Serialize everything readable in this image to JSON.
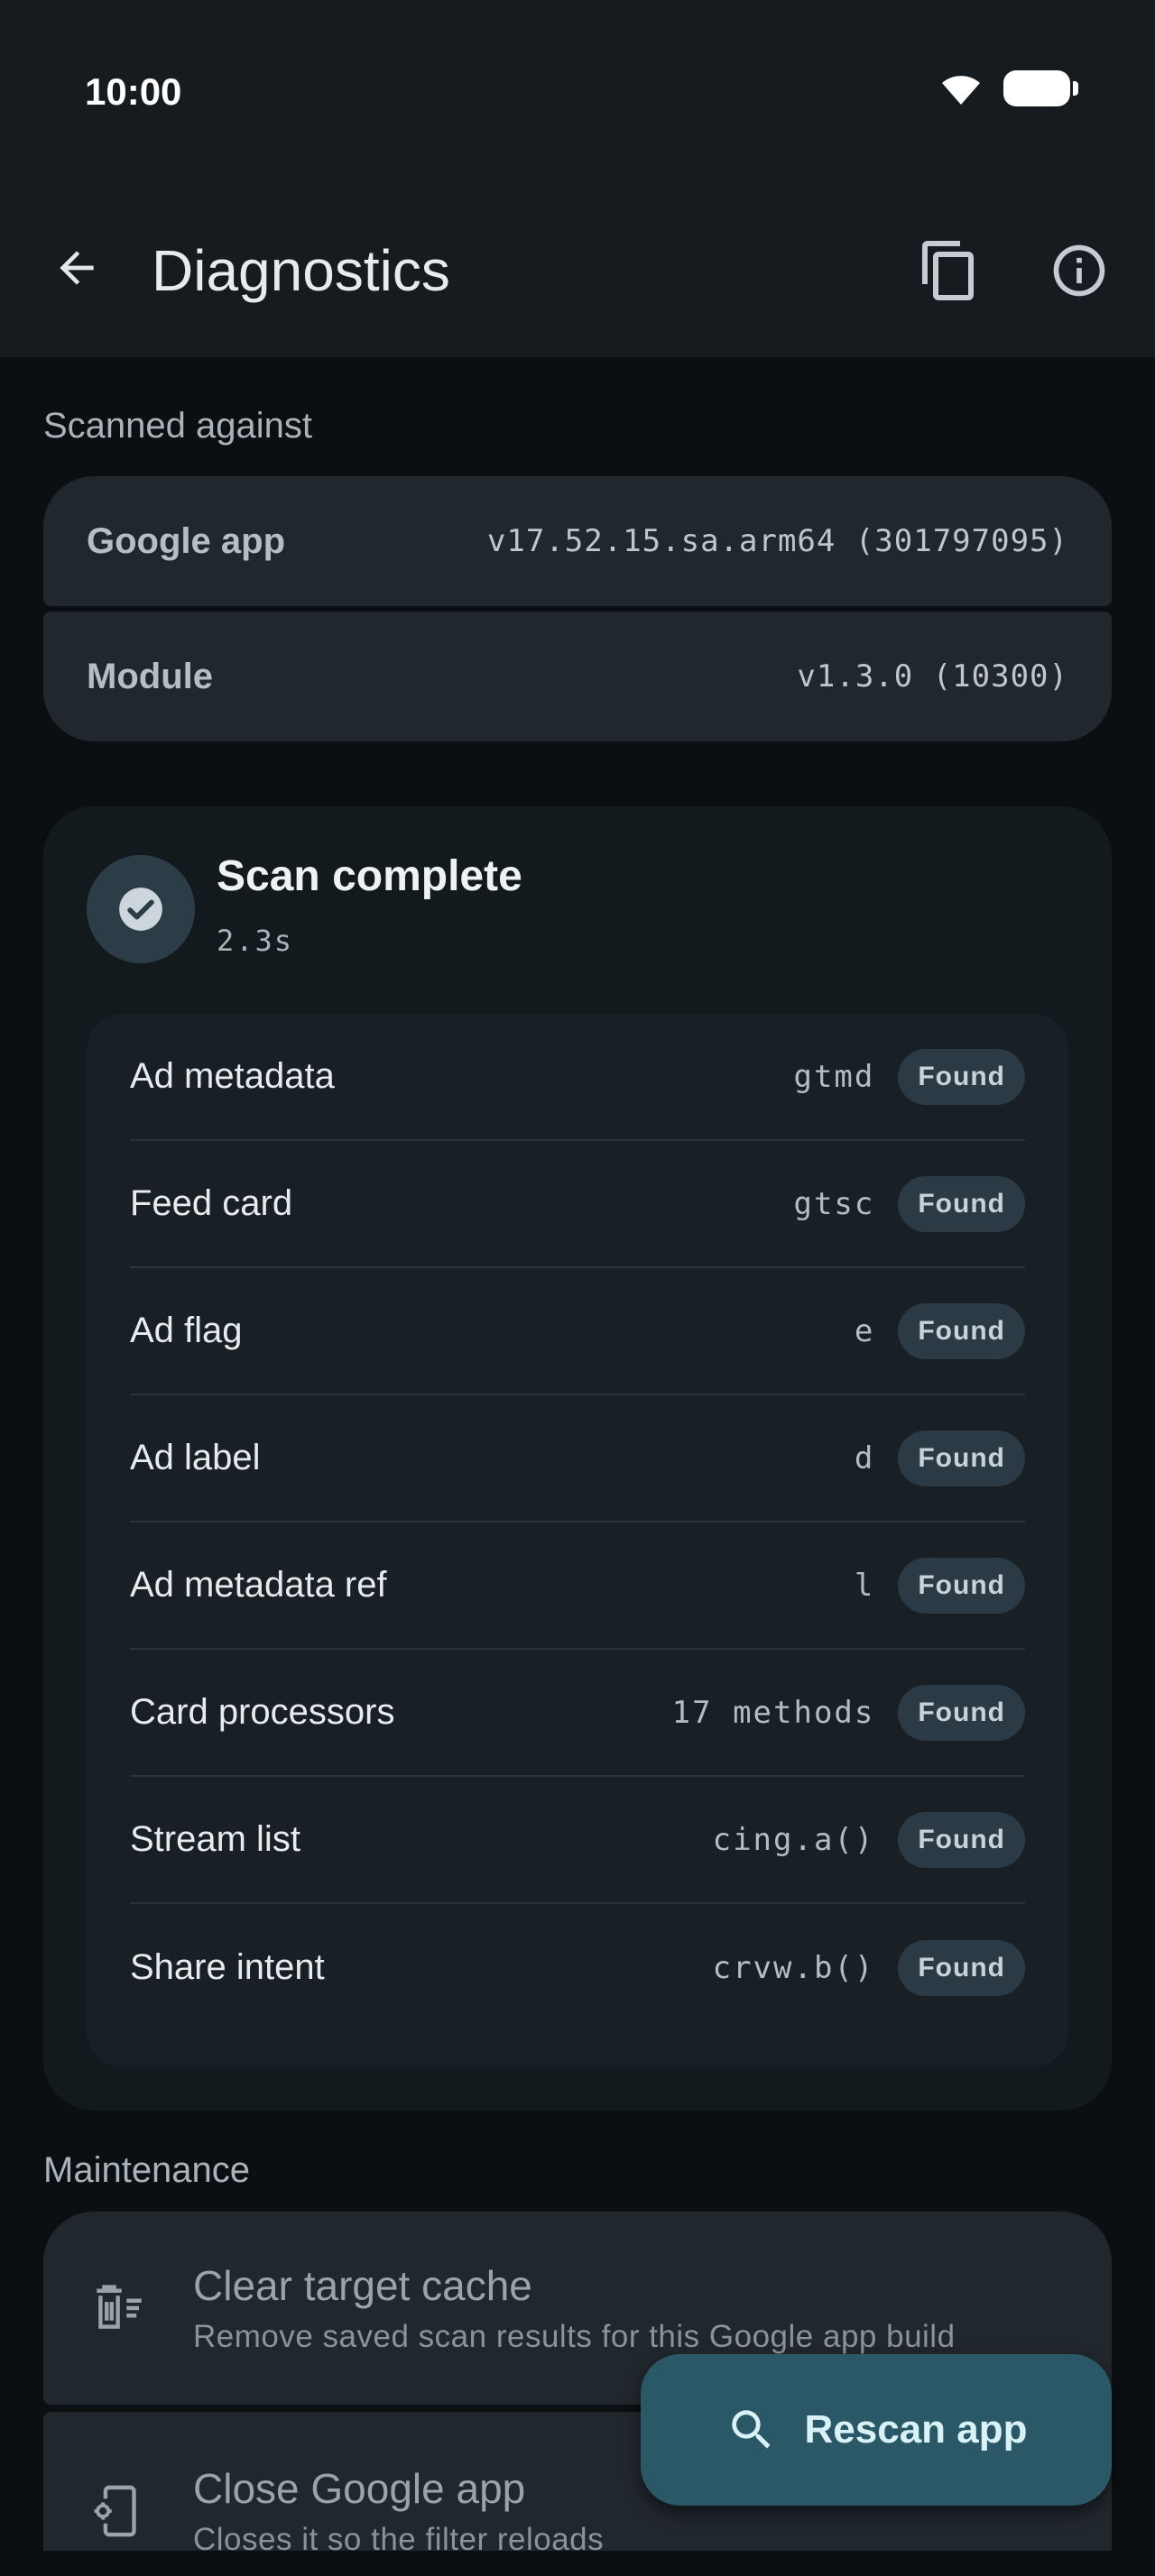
{
  "status_bar": {
    "time": "10:00"
  },
  "app_bar": {
    "title": "Diagnostics",
    "icons": [
      "back-arrow-icon",
      "copy-icon",
      "info-icon"
    ]
  },
  "scanned_against": {
    "label": "Scanned against",
    "rows": [
      {
        "key": "Google app",
        "value": "v17.52.15.sa.arm64 (301797095)"
      },
      {
        "key": "Module",
        "value": "v1.3.0 (10300)"
      }
    ]
  },
  "scan": {
    "title": "Scan complete",
    "duration": "2.3s",
    "results": [
      {
        "name": "Ad metadata",
        "value": "gtmd",
        "status": "Found"
      },
      {
        "name": "Feed card",
        "value": "gtsc",
        "status": "Found"
      },
      {
        "name": "Ad flag",
        "value": "e",
        "status": "Found"
      },
      {
        "name": "Ad label",
        "value": "d",
        "status": "Found"
      },
      {
        "name": "Ad metadata ref",
        "value": "l",
        "status": "Found"
      },
      {
        "name": "Card processors",
        "value": "17 methods",
        "status": "Found"
      },
      {
        "name": "Stream list",
        "value": "cing.a()",
        "status": "Found"
      },
      {
        "name": "Share intent",
        "value": "crvw.b()",
        "status": "Found"
      }
    ]
  },
  "maintenance": {
    "label": "Maintenance",
    "items": [
      {
        "title": "Clear target cache",
        "description": "Remove saved scan results for this Google app build",
        "icon": "clear-cache-icon"
      },
      {
        "title": "Close Google app",
        "description": "Closes it so the filter reloads",
        "icon": "close-app-icon"
      }
    ]
  },
  "fab": {
    "label": "Rescan app",
    "icon": "search-icon"
  },
  "colors": {
    "background": "#0b0f12",
    "surface": "#20272d",
    "fab": "#2b5866",
    "badge": "#2b3a44"
  }
}
